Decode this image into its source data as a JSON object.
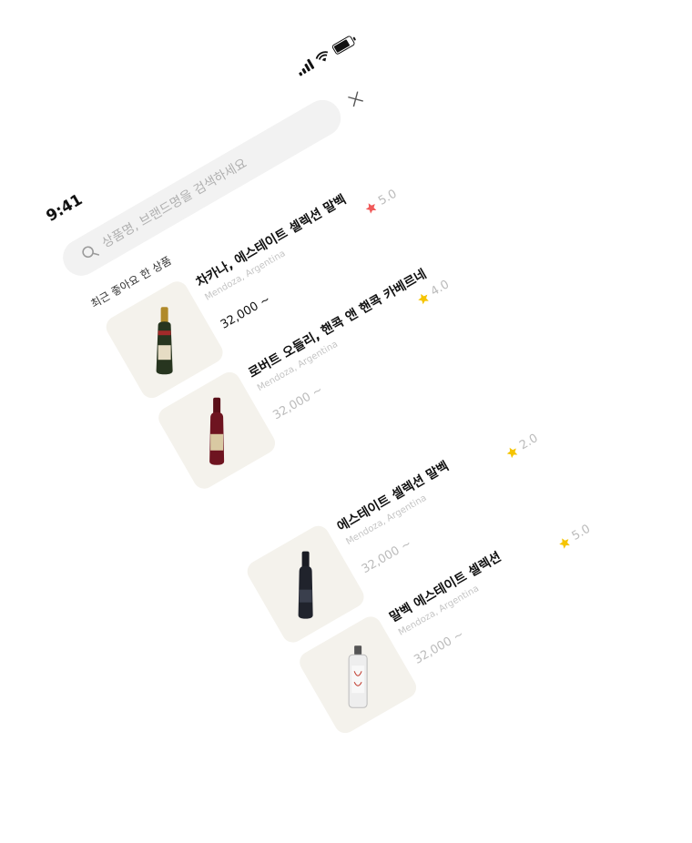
{
  "status_bar": {
    "time": "9:41"
  },
  "search": {
    "placeholder": "상품명, 브랜드명을 검색하세요"
  },
  "section_title": "최근 좋아요 한 상품",
  "items": [
    {
      "name": "차카나, 에스테이트 셀렉션 말벡",
      "region": "Mendoza, Argentina",
      "price": "32,000 ~",
      "rating": "5.0",
      "star_color": "#f05a5a"
    },
    {
      "name": "로버트 오들리, 핸콕 앤 핸콕 카베르네",
      "region": "Mendoza, Argentina",
      "price": "32,000 ~",
      "rating": "4.0",
      "star_color": "#f5c400"
    },
    {
      "name": "에스테이트 셀렉션 말벡",
      "region": "Mendoza, Argentina",
      "price": "32,000 ~",
      "rating": "2.0",
      "star_color": "#f5c400"
    },
    {
      "name": "말벡 에스테이트 셀렉션",
      "region": "Mendoza, Argentina",
      "price": "32,000 ~",
      "rating": "5.0",
      "star_color": "#f5c400"
    }
  ],
  "icons": [
    "signal-icon",
    "wifi-icon",
    "battery-icon",
    "search-icon",
    "close-icon",
    "star-icon",
    "wine-bottle-icon"
  ]
}
